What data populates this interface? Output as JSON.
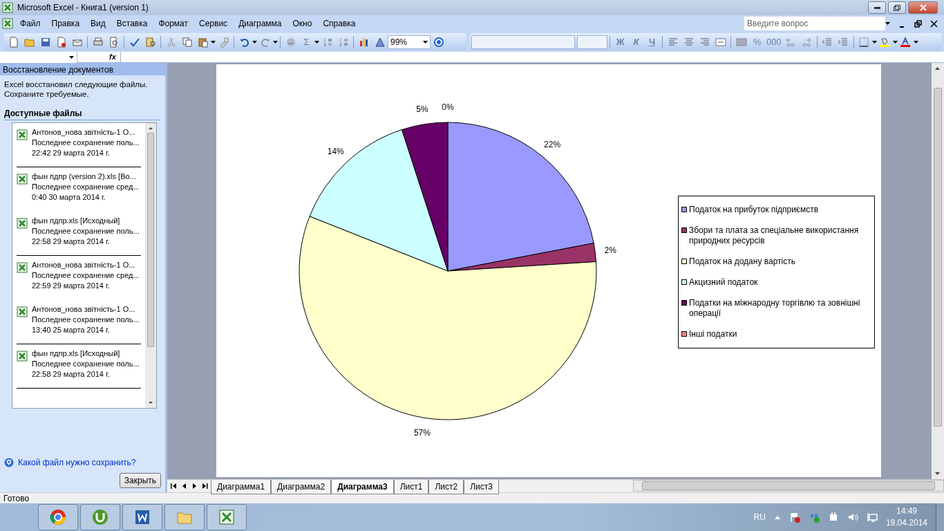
{
  "window": {
    "title": "Microsoft Excel - Книга1 (version 1)"
  },
  "menu": [
    "Файл",
    "Правка",
    "Вид",
    "Вставка",
    "Формат",
    "Сервис",
    "Диаграмма",
    "Окно",
    "Справка"
  ],
  "help_box": {
    "placeholder": "Введите вопрос"
  },
  "toolbar": {
    "sum": "Σ",
    "zoom": "99%",
    "bold": "Ж",
    "italic": "К",
    "underline": "Ч",
    "percent": "%",
    "thousands": "000"
  },
  "formula_bar": {
    "fx": "fx"
  },
  "recovery_pane": {
    "title": "Восстановление документов",
    "message": "Excel восстановил следующие файлы. Сохраните требуемые.",
    "section": "Доступные файлы",
    "files": [
      {
        "name": "Антонов_нова звітність-1 О...",
        "saved": "Последнее сохранение поль...",
        "time": "22:42 29 марта 2014 г.",
        "separator_after": true
      },
      {
        "name": "фын пдпр (version 2).xls  [Во...",
        "saved": "Последнее сохранение сред...",
        "time": "0:40 30 марта 2014 г.",
        "separator_after": false
      },
      {
        "name": "фын пдпр.xls  [Исходный]",
        "saved": "Последнее сохранение поль...",
        "time": "22:58 29 марта 2014 г.",
        "separator_after": true
      },
      {
        "name": "Антонов_нова звітність-1 О...",
        "saved": "Последнее сохранение сред...",
        "time": "22:59 29 марта 2014 г.",
        "separator_after": false
      },
      {
        "name": "Антонов_нова звітність-1 О...",
        "saved": "Последнее сохранение поль...",
        "time": "13:40 25 марта 2014 г.",
        "separator_after": true
      },
      {
        "name": "фын пдпр.xls  [Исходный]",
        "saved": "Последнее сохранение поль...",
        "time": "22:58 29 марта 2014 г.",
        "separator_after": true
      }
    ],
    "help_link": "Какой файл нужно сохранить?",
    "close_button": "Закрыть"
  },
  "chart": {
    "chart_data": {
      "type": "pie",
      "categories": [
        "Податок на прибуток підприємств",
        "Збори та плата за спеціальне використання природних ресурсів",
        "Податок на додану вартість",
        "Акцизний податок",
        "Податки на міжнародну торгівлю та зовнішні операції",
        "Інші податки"
      ],
      "values": [
        22,
        2,
        57,
        14,
        5,
        0
      ],
      "colors": [
        "#9999ff",
        "#993366",
        "#ffffcc",
        "#ccffff",
        "#660066",
        "#ff8080"
      ],
      "value_labels": [
        "22%",
        "2%",
        "57%",
        "14%",
        "5%",
        "0%"
      ]
    }
  },
  "sheet_tabs": [
    {
      "label": "Диаграмма1",
      "selected": false
    },
    {
      "label": "Диаграмма2",
      "selected": false
    },
    {
      "label": "Диаграмма3",
      "selected": true
    },
    {
      "label": "Лист1",
      "selected": false
    },
    {
      "label": "Лист2",
      "selected": false
    },
    {
      "label": "Лист3",
      "selected": false
    }
  ],
  "status_bar": {
    "text": "Готово"
  },
  "taskbar": {
    "language": "RU",
    "time": "14:49",
    "date": "19.04.2014"
  }
}
